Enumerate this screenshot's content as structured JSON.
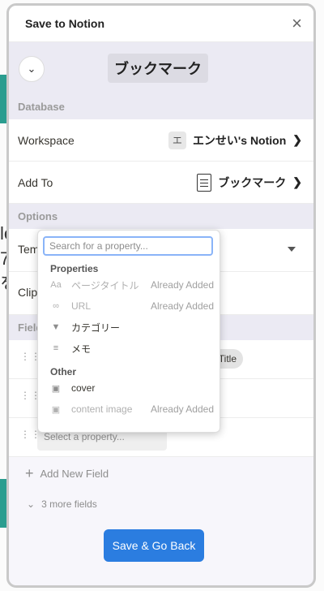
{
  "window": {
    "title": "Save to Notion"
  },
  "page": {
    "title": "ブックマーク"
  },
  "database": {
    "section_label": "Database",
    "workspace_label": "Workspace",
    "workspace_badge": "エ",
    "workspace_value": "エンせい's Notion",
    "add_to_label": "Add To",
    "add_to_value": "ブックマーク"
  },
  "options": {
    "section_label": "Options",
    "template_label": "Tem",
    "clip_label": "Clip"
  },
  "fields": {
    "section_label": "Field",
    "title_pill": "e Title",
    "select_placeholder": "Select a property...",
    "add_new": "Add New Field",
    "more": "3 more fields"
  },
  "save_button": "Save & Go Back",
  "popover": {
    "search_placeholder": "Search for a property...",
    "groups": [
      {
        "label": "Properties",
        "items": [
          {
            "icon": "Aa",
            "name": "ページタイトル",
            "status": "Already Added",
            "active": false
          },
          {
            "icon": "∞",
            "name": "URL",
            "status": "Already Added",
            "active": false
          },
          {
            "icon": "▼",
            "name": "カテゴリー",
            "status": "",
            "active": true
          },
          {
            "icon": "≡",
            "name": "メモ",
            "status": "",
            "active": true
          }
        ]
      },
      {
        "label": "Other",
        "items": [
          {
            "icon": "▣",
            "name": "cover",
            "status": "",
            "active": true
          },
          {
            "icon": "▣",
            "name": "content image",
            "status": "Already Added",
            "active": false
          }
        ]
      }
    ]
  },
  "background": {
    "text_lines": [
      "le",
      "7",
      "を"
    ]
  },
  "colors": {
    "accent": "#2b7de0",
    "focus": "#8ab4f8"
  }
}
